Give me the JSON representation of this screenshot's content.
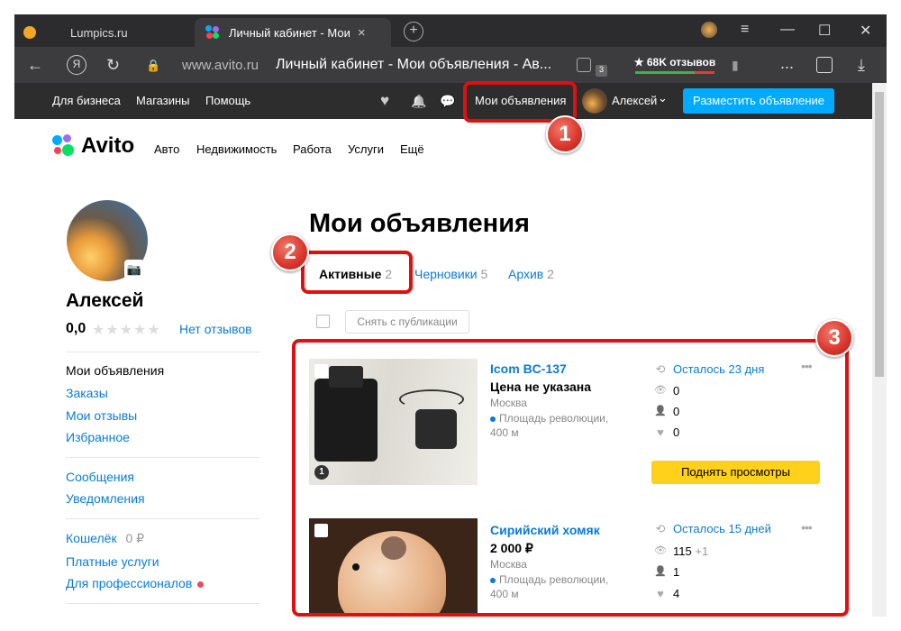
{
  "browser": {
    "tabs": [
      {
        "label": "Lumpics.ru"
      },
      {
        "label": "Личный кабинет - Мои",
        "close": "×"
      }
    ],
    "new_tab": "+",
    "domain": "www.avito.ru",
    "page_title": "Личный кабинет - Мои объявления - Ав...",
    "rating_chip": "★ 68K отзывов",
    "extensions_count": "3",
    "window_controls": {
      "menu": "≡",
      "minimize": "—",
      "maximize": "☐",
      "close": "✕"
    },
    "icons": {
      "back": "←",
      "yandex": "Я",
      "reload": "↻",
      "lock": "🔒",
      "bookmark": "▮",
      "more": "...",
      "download": "⤓"
    }
  },
  "topbar": {
    "links": [
      "Для бизнеса",
      "Магазины",
      "Помощь"
    ],
    "my_ads": "Мои объявления",
    "user": "Алексей",
    "user_chevron": "⌄",
    "place_ad": "Разместить объявление",
    "icons": {
      "favorites": "♥",
      "notifications": "🔔",
      "messages": "💬"
    }
  },
  "site": {
    "logo": "Avito",
    "categories": [
      "Авто",
      "Недвижимость",
      "Работа",
      "Услуги",
      "Ещё"
    ]
  },
  "profile": {
    "name": "Алексей",
    "rating": "0,0",
    "stars": "★★★★★",
    "no_reviews": "Нет отзывов",
    "camera_icon": "📷",
    "menu_group1": [
      "Мои объявления",
      "Заказы",
      "Мои отзывы",
      "Избранное"
    ],
    "menu_group2": [
      "Сообщения",
      "Уведомления"
    ],
    "wallet_label": "Кошелёк",
    "wallet_amount": "0 ₽",
    "paid_services": "Платные услуги",
    "for_pros": "Для профессионалов"
  },
  "main": {
    "title": "Мои объявления",
    "tabs": [
      {
        "label": "Активные",
        "count": "2"
      },
      {
        "label": "Черновики",
        "count": "5"
      },
      {
        "label": "Архив",
        "count": "2"
      }
    ],
    "unpublish": "Снять с публикации"
  },
  "listings": [
    {
      "title": "Icom BC-137",
      "price": "Цена не указана",
      "city": "Москва",
      "metro": "Площадь революции, 400 м",
      "remaining": "Осталось 23 дня",
      "views": "0",
      "views_plus": "",
      "contacts": "0",
      "favorites": "0",
      "photo_count": "1",
      "boost": "Поднять просмотры",
      "more": "•••"
    },
    {
      "title": "Сирийский хомяк",
      "price": "2 000 ₽",
      "city": "Москва",
      "metro": "Площадь революции, 400 м",
      "remaining": "Осталось 15 дней",
      "views": "115",
      "views_plus": "+1",
      "contacts": "1",
      "favorites": "4",
      "more": "•••"
    }
  ],
  "callouts": [
    "1",
    "2",
    "3"
  ],
  "stat_icons": {
    "renew": "⟲",
    "views": "👁",
    "contacts": "👤",
    "favorites": "♥"
  }
}
